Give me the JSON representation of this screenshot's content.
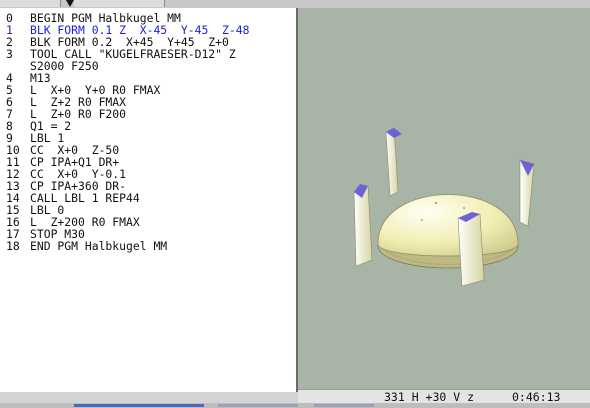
{
  "program": {
    "lines": [
      {
        "no": "0",
        "text": "BEGIN PGM Halbkugel MM"
      },
      {
        "no": "1",
        "text": "BLK FORM 0.1 Z  X-45  Y-45  Z-48"
      },
      {
        "no": "2",
        "text": "BLK FORM 0.2  X+45  Y+45  Z+0"
      },
      {
        "no": "3",
        "text": "TOOL CALL \"KUGELFRAESER-D12\" Z"
      },
      {
        "no": "",
        "text": "S2000 F250"
      },
      {
        "no": "4",
        "text": "M13"
      },
      {
        "no": "5",
        "text": "L  X+0  Y+0 R0 FMAX"
      },
      {
        "no": "6",
        "text": "L  Z+2 R0 FMAX"
      },
      {
        "no": "7",
        "text": "L  Z+0 R0 F200"
      },
      {
        "no": "8",
        "text": "Q1 = 2"
      },
      {
        "no": "9",
        "text": "LBL 1"
      },
      {
        "no": "10",
        "text": "CC  X+0  Z-50"
      },
      {
        "no": "11",
        "text": "CP IPA+Q1 DR+"
      },
      {
        "no": "12",
        "text": "CC  X+0  Y-0.1"
      },
      {
        "no": "13",
        "text": "CP IPA+360 DR-"
      },
      {
        "no": "14",
        "text": "CALL LBL 1 REP44"
      },
      {
        "no": "15",
        "text": "LBL 0"
      },
      {
        "no": "16",
        "text": "L  Z+200 R0 FMAX"
      },
      {
        "no": "17",
        "text": "STOP M30"
      },
      {
        "no": "18",
        "text": "END PGM Halbkugel MM"
      }
    ],
    "active_line_index": 1,
    "active_color": "#1a22d8"
  },
  "simulation": {
    "background_color": "#a7b4a6",
    "dome_color": "#f3efb6"
  },
  "status": {
    "view": "331 H +30 V z",
    "time": "0:46:13"
  }
}
